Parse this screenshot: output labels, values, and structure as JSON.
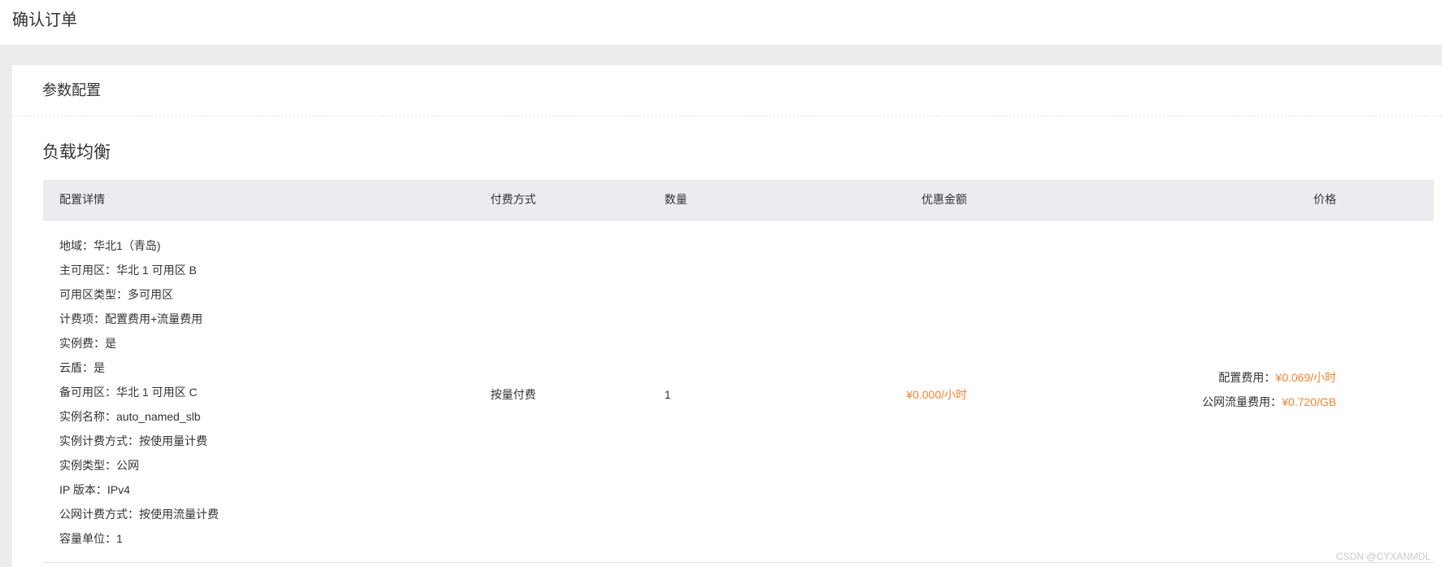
{
  "page_title": "确认订单",
  "section_title": "参数配置",
  "product_title": "负载均衡",
  "table": {
    "headers": {
      "config": "配置详情",
      "payment": "付费方式",
      "quantity": "数量",
      "discount": "优惠金额",
      "price": "价格"
    },
    "row": {
      "config_details": [
        "地域：华北1（青岛)",
        "主可用区：华北 1 可用区 B",
        "可用区类型：多可用区",
        "计费项：配置费用+流量费用",
        "实例费：是",
        "云盾：是",
        "备可用区：华北 1 可用区 C",
        "实例名称：auto_named_slb",
        "实例计费方式：按使用量计费",
        "实例类型：公网",
        "IP 版本：IPv4",
        "公网计费方式：按使用流量计费",
        "容量单位：1"
      ],
      "payment": "按量付费",
      "quantity": "1",
      "discount": "¥0.000/小时",
      "price_lines": [
        {
          "label": "配置费用：",
          "value": "¥0.069/小时"
        },
        {
          "label": "公网流量费用：",
          "value": "¥0.720/GB"
        }
      ]
    }
  },
  "watermark": "CSDN @CYXANMDL",
  "colors": {
    "accent_orange": "#f5832e",
    "header_bg": "#eaecf0",
    "page_bg": "#ececec"
  }
}
